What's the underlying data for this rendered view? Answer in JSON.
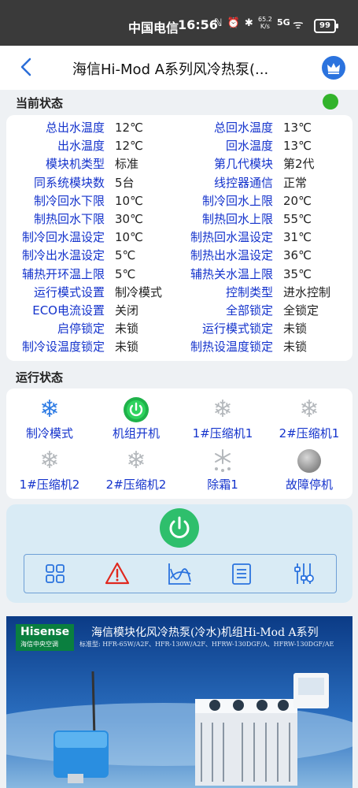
{
  "statusbar": {
    "carrier": "中国电信",
    "time": "16:56",
    "icons": "ℕ ⏰ ✱",
    "speed_value": "65.2",
    "speed_unit": "K/s",
    "network": "5G",
    "battery": "99"
  },
  "nav": {
    "back_icon": "chevron-left-icon",
    "title": "海信Hi-Mod A系列风冷热泵(...",
    "crown_icon": "crown-icon"
  },
  "current": {
    "title": "当前状态",
    "indicator_color": "#32b32b",
    "rows": [
      {
        "l1": "总出水温度",
        "v1": "12℃",
        "l2": "总回水温度",
        "v2": "13℃"
      },
      {
        "l1": "出水温度",
        "v1": "12℃",
        "l2": "回水温度",
        "v2": "13℃"
      },
      {
        "l1": "模块机类型",
        "v1": "标准",
        "l2": "第几代模块",
        "v2": "第2代"
      },
      {
        "l1": "同系统模块数",
        "v1": "5台",
        "l2": "线控器通信",
        "v2": "正常"
      },
      {
        "l1": "制冷回水下限",
        "v1": "10℃",
        "l2": "制冷回水上限",
        "v2": "20℃"
      },
      {
        "l1": "制热回水下限",
        "v1": "30℃",
        "l2": "制热回水上限",
        "v2": "55℃"
      },
      {
        "l1": "制冷回水温设定",
        "v1": "10℃",
        "l2": "制热回水温设定",
        "v2": "31℃"
      },
      {
        "l1": "制冷出水温设定",
        "v1": "5℃",
        "l2": "制热出水温设定",
        "v2": "36℃"
      },
      {
        "l1": "辅热开环温上限",
        "v1": "5℃",
        "l2": "辅热关水温上限",
        "v2": "35℃"
      },
      {
        "l1": "运行模式设置",
        "v1": "制冷模式",
        "l2": "控制类型",
        "v2": "进水控制"
      },
      {
        "l1": "ECO电流设置",
        "v1": "关闭",
        "l2": "全部锁定",
        "v2": "全锁定"
      },
      {
        "l1": "启停锁定",
        "v1": "未锁",
        "l2": "运行模式锁定",
        "v2": "未锁"
      },
      {
        "l1": "制冷设温度锁定",
        "v1": "未锁",
        "l2": "制热设温度锁定",
        "v2": "未锁"
      }
    ]
  },
  "operation": {
    "title": "运行状态",
    "items": [
      {
        "label": "制冷模式",
        "icon": "snowflake-icon"
      },
      {
        "label": "机组开机",
        "icon": "power-on-icon"
      },
      {
        "label": "1#压缩机1",
        "icon": "snowflake-icon"
      },
      {
        "label": "2#压缩机1",
        "icon": "snowflake-icon"
      },
      {
        "label": "1#压缩机2",
        "icon": "snowflake-icon"
      },
      {
        "label": "2#压缩机2",
        "icon": "snowflake-icon"
      },
      {
        "label": "除霜1",
        "icon": "defrost-icon"
      },
      {
        "label": "故障停机",
        "icon": "fault-stop-icon"
      }
    ],
    "snow_glyph": "❄"
  },
  "controls": {
    "tools": [
      "grid-icon",
      "warning-icon",
      "chart-icon",
      "list-icon",
      "settings-sliders-icon"
    ]
  },
  "banner": {
    "logo": "Hisense",
    "logo_sub": "海信中央空调",
    "headline": "海信模块化风冷热泵(冷水)机组Hi-Mod A系列",
    "models": "标准型: HFR-65W/A2F、HFR-130W/A2F、HFRW-130DGF/A、HFRW-130DGF/AE"
  }
}
